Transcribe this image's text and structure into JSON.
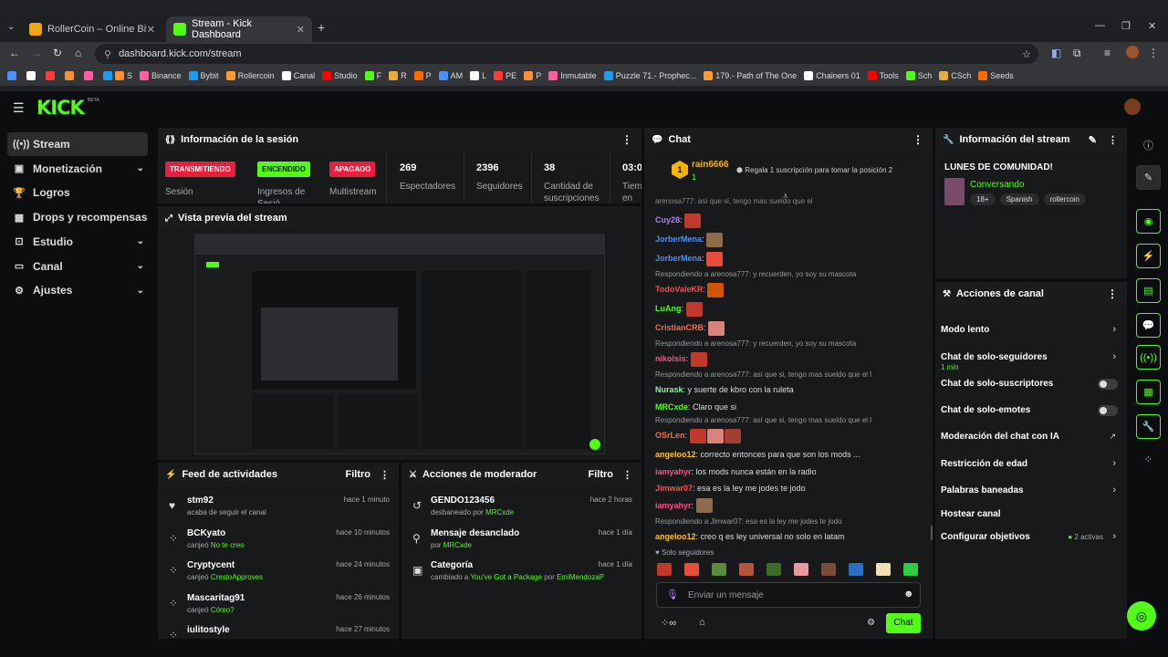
{
  "browser": {
    "tabs": [
      {
        "title": "RollerCoin – Online Bitcoin Mini",
        "active": false
      },
      {
        "title": "Stream - Kick Dashboard",
        "active": true
      }
    ],
    "url": "dashboard.kick.com/stream",
    "bookmarks": [
      "S",
      "Binance",
      "Bybit",
      "Rollercoin",
      "Canal",
      "Studio",
      "F",
      "R",
      "P",
      "AM",
      "L",
      "PE",
      "P",
      "Inmutable",
      "Puzzle 71.- Prophec...",
      "179.- Path of The One",
      "Chainers 01",
      "Tools",
      "Sch",
      "CSch",
      "Seeds"
    ]
  },
  "brand": {
    "logo": "KICK",
    "tag": "BETA"
  },
  "sidebar": {
    "items": [
      {
        "label": "Stream",
        "icon": "broadcast-icon",
        "active": true,
        "chev": false
      },
      {
        "label": "Monetización",
        "icon": "money-icon",
        "active": false,
        "chev": true
      },
      {
        "label": "Logros",
        "icon": "trophy-icon",
        "active": false,
        "chev": false
      },
      {
        "label": "Drops y recompensas",
        "icon": "gift-icon",
        "active": false,
        "chev": false
      },
      {
        "label": "Estudio",
        "icon": "studio-icon",
        "active": false,
        "chev": true
      },
      {
        "label": "Canal",
        "icon": "channel-icon",
        "active": false,
        "chev": true
      },
      {
        "label": "Ajustes",
        "icon": "gear-icon",
        "active": false,
        "chev": true
      }
    ]
  },
  "session": {
    "title": "Información de la sesión",
    "badges": [
      {
        "label": "TRANSMITIENDO",
        "caption": "Sesión",
        "color": "#e91e3c"
      },
      {
        "label": "ENCENDIDO",
        "caption": "Ingresos de Sesió",
        "color": "#53fc18"
      },
      {
        "label": "APAGADO",
        "caption": "Multistream",
        "color": "#e91e3c"
      }
    ],
    "stats": [
      {
        "value": "269",
        "label": "Espectadores"
      },
      {
        "value": "2396",
        "label": "Seguidores"
      },
      {
        "value": "38",
        "label": "Cantidad de suscripciones"
      },
      {
        "value": "03:0",
        "label": "Tiem en vi"
      }
    ]
  },
  "preview": {
    "title": "Vista previa del stream"
  },
  "feed": {
    "title": "Feed de actividades",
    "filter": "Filtro",
    "items": [
      {
        "name": "stm92",
        "sub": "acaba de seguir el canal",
        "hl": "",
        "time": "hace 1 minuto",
        "icon": "heart-icon"
      },
      {
        "name": "BCKyato",
        "sub": "canjeó",
        "hl": "No te creo",
        "time": "hace 10 minutos",
        "icon": "points-icon"
      },
      {
        "name": "Cryptycent",
        "sub": "canjeó",
        "hl": "CrestoApproves",
        "time": "hace 24 minutos",
        "icon": "points-icon"
      },
      {
        "name": "Mascaritag91",
        "sub": "canjeó",
        "hl": "Cómo?",
        "time": "hace 26 minutos",
        "icon": "points-icon"
      },
      {
        "name": "iulitostyle",
        "sub": "",
        "hl": "",
        "time": "hace 27 minutos",
        "icon": "points-icon"
      }
    ]
  },
  "mod": {
    "title": "Acciones de moderador",
    "filter": "Filtro",
    "items": [
      {
        "name": "GENDO123456",
        "sub": "desbaneado por",
        "hl": "MRCxde",
        "time": "hace 2 horas",
        "icon": "unban-icon"
      },
      {
        "name": "Mensaje desanclado",
        "sub": "por",
        "hl": "MRCxde",
        "time": "hace 1 día",
        "icon": "unpin-icon"
      },
      {
        "name": "Categoría",
        "sub": "cambiado a",
        "hl": "You've Got a Package",
        "sub2": "por",
        "hl2": "EmiMendozaP",
        "time": "hace 1 día",
        "icon": "category-icon"
      }
    ]
  },
  "chat": {
    "title": "Chat",
    "gift_user": "rain6666",
    "gift_count": "1",
    "gift_text": "Regala 1 suscripción para tomar la posición 2",
    "top_line": "arenosa777: así que si, tengo mas sueldo que el",
    "lines": [
      {
        "user": "Cuy28",
        "color": "#b57bff",
        "text": "",
        "emotes": 1
      },
      {
        "user": "JorberMena",
        "color": "#4a90ff",
        "text": "",
        "emotes": 1
      },
      {
        "user": "JorberMena",
        "color": "#4a90ff",
        "text": "",
        "emotes": 1
      },
      {
        "reply": "Respondiendo a arenosa777: y recuerden, yo soy su mascota"
      },
      {
        "user": "TodoValeKR",
        "color": "#ff4b4b",
        "text": "",
        "emotes": 1
      },
      {
        "user": "LuAng",
        "color": "#53fc18",
        "text": "",
        "emotes": 1
      },
      {
        "user": "CristianCRB",
        "color": "#ff6a3d",
        "text": "",
        "emotes": 1
      },
      {
        "reply": "Respondiendo a arenosa777: y recuerden, yo soy su mascota"
      },
      {
        "user": "nikolsis",
        "color": "#ff4b8a",
        "text": "",
        "emotes": 1
      },
      {
        "reply": "Respondiendo a arenosa777: así que si, tengo mas sueldo que el l"
      },
      {
        "user": "Nurask",
        "color": "#7dff9a",
        "text": "y suerte de kbro con la ruleta",
        "emotes": 0
      },
      {
        "user": "MRCxde",
        "color": "#53fc18",
        "text": "Claro que si",
        "emotes": 0
      },
      {
        "reply": "Respondiendo a arenosa777: así que si, tengo mas sueldo que el l"
      },
      {
        "user": "OSrLen",
        "color": "#ff6a3d",
        "text": "",
        "emotes": 3
      },
      {
        "user": "angeloo12",
        "color": "#ffc21a",
        "text": "correcto entonces para que son los mods ...",
        "emotes": 0
      },
      {
        "user": "iamyahyr",
        "color": "#ff4b8a",
        "text": "los mods nunca están en la radio",
        "emotes": 0
      },
      {
        "user": "Jimwar07",
        "color": "#ff4b4b",
        "text": "esa es la ley me jodes te jodo",
        "emotes": 0
      },
      {
        "user": "iamyahyr",
        "color": "#ff4b8a",
        "text": "",
        "emotes": 1
      },
      {
        "reply": "Respondiendo a Jimwar07: esa es la ley me jodes te jodo"
      },
      {
        "user": "angeloo12",
        "color": "#ffc21a",
        "text": "creo q es ley universal no solo en latam",
        "emotes": 0
      }
    ],
    "followers_only": "Solo seguidores",
    "input_placeholder": "Enviar un mensaje",
    "send_label": "Chat"
  },
  "stream_info": {
    "title": "Información del stream",
    "stream_title": "LUNES DE COMUNIDAD!",
    "category": "Conversando",
    "tags": [
      "18+",
      "Spanish",
      "rollercoin"
    ]
  },
  "channel_actions": {
    "title": "Acciones de canal",
    "items": [
      {
        "label": "Modo lento",
        "sub": "",
        "control": "chev"
      },
      {
        "label": "Chat de solo-seguidores",
        "sub": "1 min",
        "control": "chev"
      },
      {
        "label": "Chat de solo-suscriptores",
        "sub": "",
        "control": "toggle"
      },
      {
        "label": "Chat de solo-emotes",
        "sub": "",
        "control": "toggle"
      },
      {
        "label": "Moderación del chat con IA",
        "sub": "",
        "control": "link"
      },
      {
        "label": "Restricción de edad",
        "sub": "",
        "control": "chev"
      },
      {
        "label": "Palabras baneadas",
        "sub": "",
        "control": "chev"
      },
      {
        "label": "Hostear canal",
        "sub": "",
        "control": "none"
      },
      {
        "label": "Configurar objetivos",
        "sub": "",
        "control": "chev",
        "extra": "2 activas"
      }
    ]
  }
}
